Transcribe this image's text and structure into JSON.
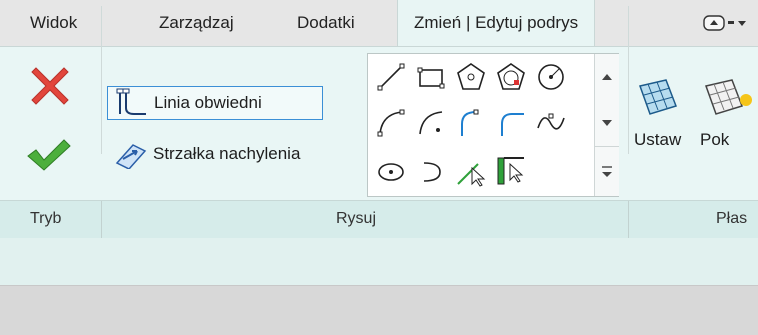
{
  "tabs": [
    {
      "label": "Widok"
    },
    {
      "label": "Zarządzaj"
    },
    {
      "label": "Dodatki"
    },
    {
      "label": "Zmień | Edytuj podrys",
      "active": true
    }
  ],
  "ribbon": {
    "mode_group": {
      "label": "Tryb",
      "cancel_icon": "red-x-icon",
      "finish_icon": "green-check-icon"
    },
    "draw_group": {
      "label": "Rysuj",
      "commands": [
        {
          "label": "Linia obwiedni",
          "icon": "boundary-line-icon",
          "selected": true
        },
        {
          "label": "Strzałka nachylenia",
          "icon": "slope-arrow-icon",
          "selected": false
        }
      ],
      "gallery_icons": [
        "line-icon",
        "rectangle-icon",
        "inscribed-polygon-icon",
        "circumscribed-polygon-icon",
        "circle-icon",
        "start-end-arc-icon",
        "center-ends-arc-icon",
        "tangent-arc-icon",
        "fillet-arc-icon",
        "spline-icon",
        "ellipse-icon",
        "partial-ellipse-icon",
        "pick-lines-icon",
        "pick-walls-icon"
      ]
    },
    "plane_group": {
      "label": "Płas",
      "set_label": "Ustaw",
      "show_label": "Pok"
    }
  },
  "colors": {
    "ribbon_bg": "#e9f6f5",
    "footer_bg": "#d6ecea",
    "accent": "#3b8fd6",
    "cancel": "#e2463c",
    "finish": "#3f9a33"
  }
}
